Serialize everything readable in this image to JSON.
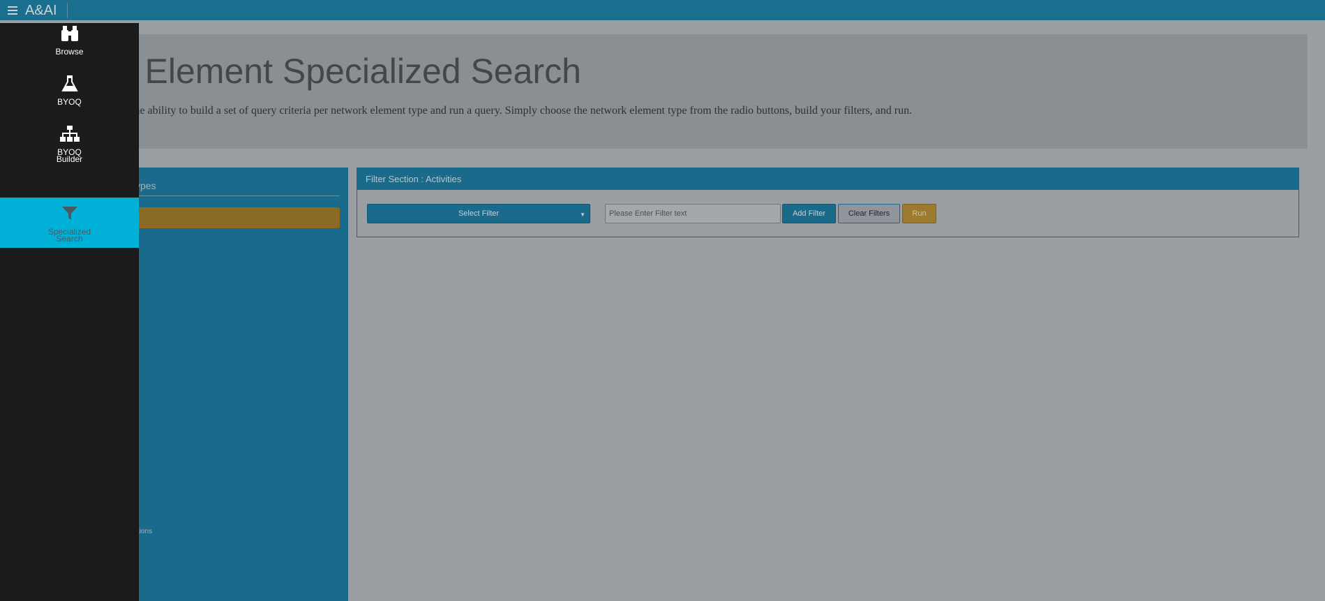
{
  "topbar": {
    "menu_icon": "hamburger-icon",
    "app_title": "A&AI"
  },
  "jumbotron": {
    "title": "rk Element Specialized Search",
    "description": "the ability to build a set of query criteria per network element type and run a query. Simply choose the network element type from the radio buttons, build your filters, and run."
  },
  "left_panel": {
    "header": "ypes",
    "bottom_item": "ctions"
  },
  "filter_section": {
    "header": "Filter Section : Activities",
    "select_label": "Select Filter",
    "input_placeholder": "Please Enter Filter text",
    "input_value": "",
    "add_label": "Add Filter",
    "clear_label": "Clear Filters",
    "run_label": "Run"
  },
  "side_nav": {
    "items": [
      {
        "label": "Browse",
        "icon": "binoculars-icon"
      },
      {
        "label": "BYOQ",
        "icon": "flask-icon"
      },
      {
        "label_line1": "BYOQ",
        "label_line2": "Builder",
        "icon": "sitemap-icon"
      },
      {
        "label_line1": "Specialized",
        "label_line2": "Search",
        "icon": "filter-icon",
        "active": true
      }
    ]
  },
  "colors": {
    "topbar": "#1a6f8f",
    "panel_blue": "#1a6b8b",
    "nav_bg": "#1b1b1b",
    "nav_active": "#00b0d6",
    "run_button": "#9c7a2e"
  }
}
